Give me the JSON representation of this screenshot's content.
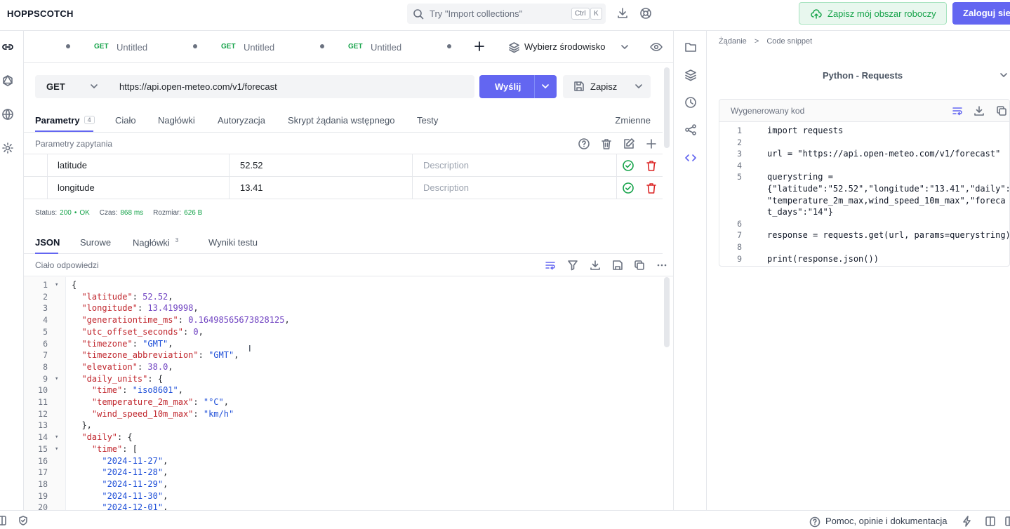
{
  "app": {
    "logo": "HOPPSCOTCH"
  },
  "header": {
    "search_placeholder": "Try \"Import collections\"",
    "kbd_ctrl": "Ctrl",
    "kbd_k": "K",
    "save_workspace": "Zapisz mój obszar roboczy",
    "login": "Zaloguj sie"
  },
  "tabs": [
    {
      "method": "GET",
      "title": "Untitled"
    },
    {
      "method": "GET",
      "title": "Untitled"
    },
    {
      "method": "GET",
      "title": "Untitled"
    }
  ],
  "environment": {
    "label": "Wybierz środowisko"
  },
  "request": {
    "method": "GET",
    "url": "https://api.open-meteo.com/v1/forecast",
    "send_label": "Wyślij",
    "save_label": "Zapisz"
  },
  "request_tabs": {
    "params": "Parametry",
    "params_count": "4",
    "body": "Ciało",
    "headers": "Nagłówki",
    "auth": "Autoryzacja",
    "prerequest": "Skrypt żądania wstępnego",
    "tests": "Testy",
    "variables": "Zmienne"
  },
  "params": {
    "title": "Parametry zapytania",
    "rows": [
      {
        "key": "latitude",
        "value": "52.52",
        "description": "Description"
      },
      {
        "key": "longitude",
        "value": "13.41",
        "description": "Description"
      }
    ]
  },
  "status": {
    "status_label": "Status:",
    "status_code": "200",
    "status_sep": "•",
    "status_text": "OK",
    "time_label": "Czas:",
    "time_value": "868 ms",
    "size_label": "Rozmiar:",
    "size_value": "626 B"
  },
  "response_tabs": {
    "json": "JSON",
    "raw": "Surowe",
    "headers": "Nagłówki",
    "headers_count": "3",
    "test_results": "Wyniki testu"
  },
  "response_body": {
    "title": "Ciało odpowiedzi",
    "lines": [
      {
        "n": "1",
        "fold": "▾",
        "parts": [
          [
            "p",
            "{"
          ]
        ]
      },
      {
        "n": "2",
        "fold": "",
        "parts": [
          [
            "p",
            "  "
          ],
          [
            "k",
            "\"latitude\""
          ],
          [
            "p",
            ": "
          ],
          [
            "n",
            "52.52"
          ],
          [
            "p",
            ","
          ]
        ]
      },
      {
        "n": "3",
        "fold": "",
        "parts": [
          [
            "p",
            "  "
          ],
          [
            "k",
            "\"longitude\""
          ],
          [
            "p",
            ": "
          ],
          [
            "n",
            "13.419998"
          ],
          [
            "p",
            ","
          ]
        ]
      },
      {
        "n": "4",
        "fold": "",
        "parts": [
          [
            "p",
            "  "
          ],
          [
            "k",
            "\"generationtime_ms\""
          ],
          [
            "p",
            ": "
          ],
          [
            "n",
            "0.16498565673828125"
          ],
          [
            "p",
            ","
          ]
        ]
      },
      {
        "n": "5",
        "fold": "",
        "parts": [
          [
            "p",
            "  "
          ],
          [
            "k",
            "\"utc_offset_seconds\""
          ],
          [
            "p",
            ": "
          ],
          [
            "n",
            "0"
          ],
          [
            "p",
            ","
          ]
        ]
      },
      {
        "n": "6",
        "fold": "",
        "parts": [
          [
            "p",
            "  "
          ],
          [
            "k",
            "\"timezone\""
          ],
          [
            "p",
            ": "
          ],
          [
            "s",
            "\"GMT\""
          ],
          [
            "p",
            ","
          ]
        ]
      },
      {
        "n": "7",
        "fold": "",
        "parts": [
          [
            "p",
            "  "
          ],
          [
            "k",
            "\"timezone_abbreviation\""
          ],
          [
            "p",
            ": "
          ],
          [
            "s",
            "\"GMT\""
          ],
          [
            "p",
            ","
          ]
        ]
      },
      {
        "n": "8",
        "fold": "",
        "parts": [
          [
            "p",
            "  "
          ],
          [
            "k",
            "\"elevation\""
          ],
          [
            "p",
            ": "
          ],
          [
            "n",
            "38.0"
          ],
          [
            "p",
            ","
          ]
        ]
      },
      {
        "n": "9",
        "fold": "▾",
        "parts": [
          [
            "p",
            "  "
          ],
          [
            "k",
            "\"daily_units\""
          ],
          [
            "p",
            ": {"
          ]
        ]
      },
      {
        "n": "10",
        "fold": "",
        "parts": [
          [
            "p",
            "    "
          ],
          [
            "k",
            "\"time\""
          ],
          [
            "p",
            ": "
          ],
          [
            "s",
            "\"iso8601\""
          ],
          [
            "p",
            ","
          ]
        ]
      },
      {
        "n": "11",
        "fold": "",
        "parts": [
          [
            "p",
            "    "
          ],
          [
            "k",
            "\"temperature_2m_max\""
          ],
          [
            "p",
            ": "
          ],
          [
            "s",
            "\"°C\""
          ],
          [
            "p",
            ","
          ]
        ]
      },
      {
        "n": "12",
        "fold": "",
        "parts": [
          [
            "p",
            "    "
          ],
          [
            "k",
            "\"wind_speed_10m_max\""
          ],
          [
            "p",
            ": "
          ],
          [
            "s",
            "\"km/h\""
          ]
        ]
      },
      {
        "n": "13",
        "fold": "",
        "parts": [
          [
            "p",
            "  },"
          ]
        ]
      },
      {
        "n": "14",
        "fold": "▾",
        "parts": [
          [
            "p",
            "  "
          ],
          [
            "k",
            "\"daily\""
          ],
          [
            "p",
            ": {"
          ]
        ]
      },
      {
        "n": "15",
        "fold": "▾",
        "parts": [
          [
            "p",
            "    "
          ],
          [
            "k",
            "\"time\""
          ],
          [
            "p",
            ": ["
          ]
        ]
      },
      {
        "n": "16",
        "fold": "",
        "parts": [
          [
            "p",
            "      "
          ],
          [
            "s",
            "\"2024-11-27\""
          ],
          [
            "p",
            ","
          ]
        ]
      },
      {
        "n": "17",
        "fold": "",
        "parts": [
          [
            "p",
            "      "
          ],
          [
            "s",
            "\"2024-11-28\""
          ],
          [
            "p",
            ","
          ]
        ]
      },
      {
        "n": "18",
        "fold": "",
        "parts": [
          [
            "p",
            "      "
          ],
          [
            "s",
            "\"2024-11-29\""
          ],
          [
            "p",
            ","
          ]
        ]
      },
      {
        "n": "19",
        "fold": "",
        "parts": [
          [
            "p",
            "      "
          ],
          [
            "s",
            "\"2024-11-30\""
          ],
          [
            "p",
            ","
          ]
        ]
      },
      {
        "n": "20",
        "fold": "",
        "parts": [
          [
            "p",
            "      "
          ],
          [
            "s",
            "\"2024-12-01\""
          ],
          [
            "p",
            ","
          ]
        ]
      }
    ]
  },
  "right_panel": {
    "crumb_request": "Żądanie",
    "crumb_sep": ">",
    "crumb_snippet": "Code snippet",
    "language": "Python - Requests",
    "generated_title": "Wygenerowany kod",
    "code_lines": [
      {
        "n": "1",
        "text": "import requests"
      },
      {
        "n": "2",
        "text": ""
      },
      {
        "n": "3",
        "text": "url = \"https://api.open-meteo.com/v1/forecast\""
      },
      {
        "n": "4",
        "text": ""
      },
      {
        "n": "5",
        "text": "querystring ="
      },
      {
        "n": "",
        "text": "{\"latitude\":\"52.52\",\"longitude\":\"13.41\",\"daily\":"
      },
      {
        "n": "",
        "text": "\"temperature_2m_max,wind_speed_10m_max\",\"foreca"
      },
      {
        "n": "",
        "text": "t_days\":\"14\"}"
      },
      {
        "n": "6",
        "text": ""
      },
      {
        "n": "7",
        "text": "response = requests.get(url, params=querystring)"
      },
      {
        "n": "8",
        "text": ""
      },
      {
        "n": "9",
        "text": "print(response.json())"
      }
    ]
  },
  "footer": {
    "help": "Pomoc, opinie i dokumentacja"
  },
  "colors": {
    "accent": "#6366f1",
    "success": "#16a34a",
    "danger": "#dc2626"
  }
}
